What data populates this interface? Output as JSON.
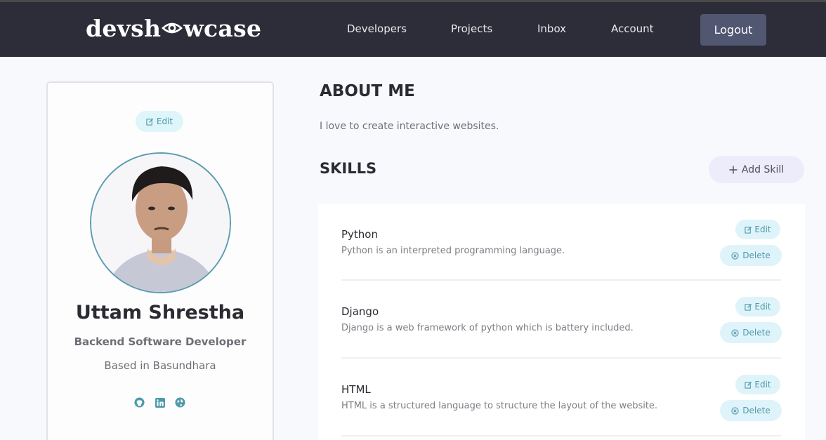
{
  "navbar": {
    "logo_prefix": "devsh",
    "logo_suffix": "wcase",
    "links": [
      "Developers",
      "Projects",
      "Inbox",
      "Account"
    ],
    "logout_label": "Logout"
  },
  "profile": {
    "edit_label": "Edit",
    "name": "Uttam Shrestha",
    "role": "Backend Software Developer",
    "location": "Based in Basundhara",
    "socials": [
      "github-icon",
      "linkedin-icon",
      "globe-icon"
    ]
  },
  "about": {
    "heading": "ABOUT ME",
    "text": "I love to create interactive websites."
  },
  "skills": {
    "heading": "SKILLS",
    "add_label": "Add Skill",
    "edit_label": "Edit",
    "delete_label": "Delete",
    "items": [
      {
        "title": "Python",
        "description": "Python is an interpreted programming language."
      },
      {
        "title": "Django",
        "description": "Django is a web framework of python which is battery included."
      },
      {
        "title": "HTML",
        "description": "HTML is a structured language to structure the layout of the website."
      }
    ]
  },
  "colors": {
    "navbar": "#2d2d39",
    "accent": "#4f9aaa",
    "pill_bg": "#dff4fa",
    "logout_bg": "#515671"
  }
}
